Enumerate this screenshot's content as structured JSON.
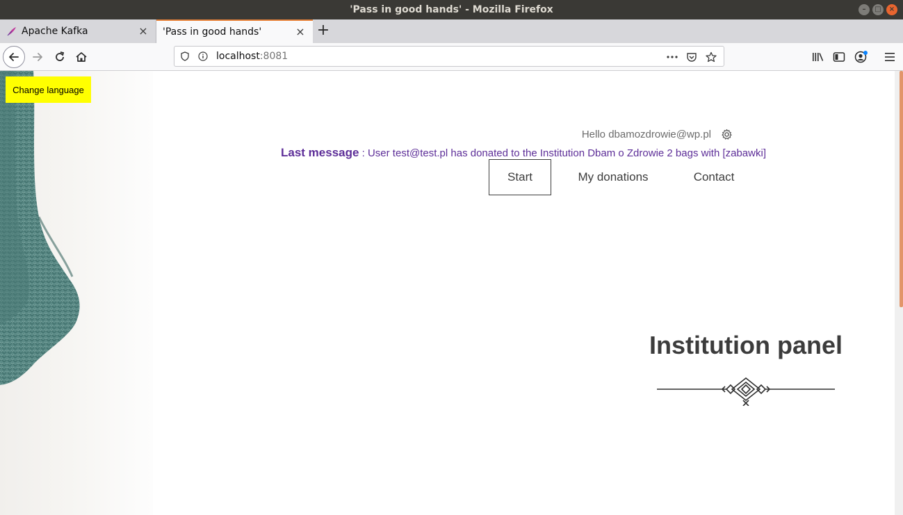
{
  "window": {
    "title": "'Pass in good hands' - Mozilla Firefox",
    "controls": {
      "minimize": "–",
      "maximize": "□",
      "close": "×"
    }
  },
  "tabs": [
    {
      "label": "Apache Kafka",
      "icon": "kafka-feather-icon",
      "active": false,
      "close": "×"
    },
    {
      "label": "'Pass in good hands'",
      "active": true,
      "close": "×"
    }
  ],
  "new_tab": "+",
  "urlbar": {
    "host": "localhost",
    "port": ":8081"
  },
  "page": {
    "change_language": "Change language",
    "greeting": "Hello dbamozdrowie@wp.pl",
    "last_message": {
      "label": "Last message",
      "separator": " : ",
      "text": "User test@test.pl has donated to the Institution Dbam o Zdrowie 2 bags with [zabawki]"
    },
    "nav": [
      {
        "label": "Start",
        "active": true
      },
      {
        "label": "My donations",
        "active": false
      },
      {
        "label": "Contact",
        "active": false
      }
    ],
    "title": "Institution panel"
  },
  "colors": {
    "accent": "#5d2e98",
    "change_language_bg": "#ffff00",
    "tab_highlight": "#e8833a",
    "text_dark": "#3c3c3c",
    "titlebar_bg": "#3a3935"
  }
}
